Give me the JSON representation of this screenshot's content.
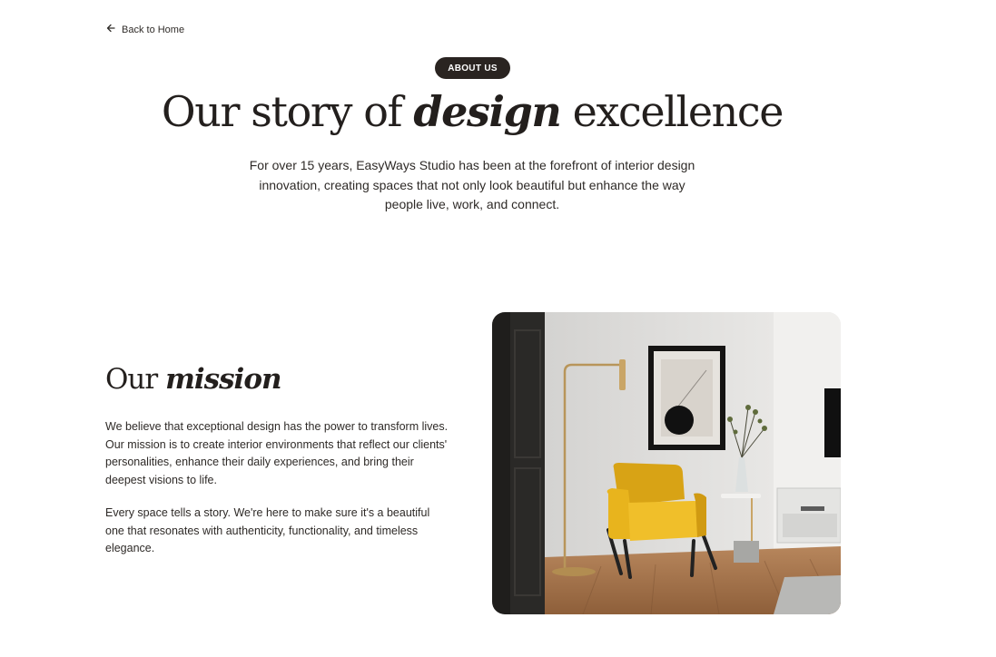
{
  "nav": {
    "back_label": "Back to Home",
    "back_icon": "arrow-left-icon"
  },
  "hero": {
    "badge": "ABOUT US",
    "title_before": "Our story of ",
    "title_emphasis": "design",
    "title_after": " excellence",
    "description": "For over 15 years, EasyWays Studio has been at the forefront of interior design innovation, creating spaces that not only look beautiful but enhance the way people live, work, and connect."
  },
  "mission": {
    "title_before": "Our ",
    "title_emphasis": "mission",
    "paragraph_1": "We believe that exceptional design has the power to transform lives. Our mission is to create interior environments that reflect our clients' personalities, enhance their daily experiences, and bring their deepest visions to life.",
    "paragraph_2": "Every space tells a story. We're here to make sure it's a beautiful one that resonates with authenticity, functionality, and timeless elegance."
  },
  "colors": {
    "badge_bg": "#2a2421",
    "text": "#231f1d",
    "chair": "#e8b41d",
    "floor": "#a9774e"
  }
}
